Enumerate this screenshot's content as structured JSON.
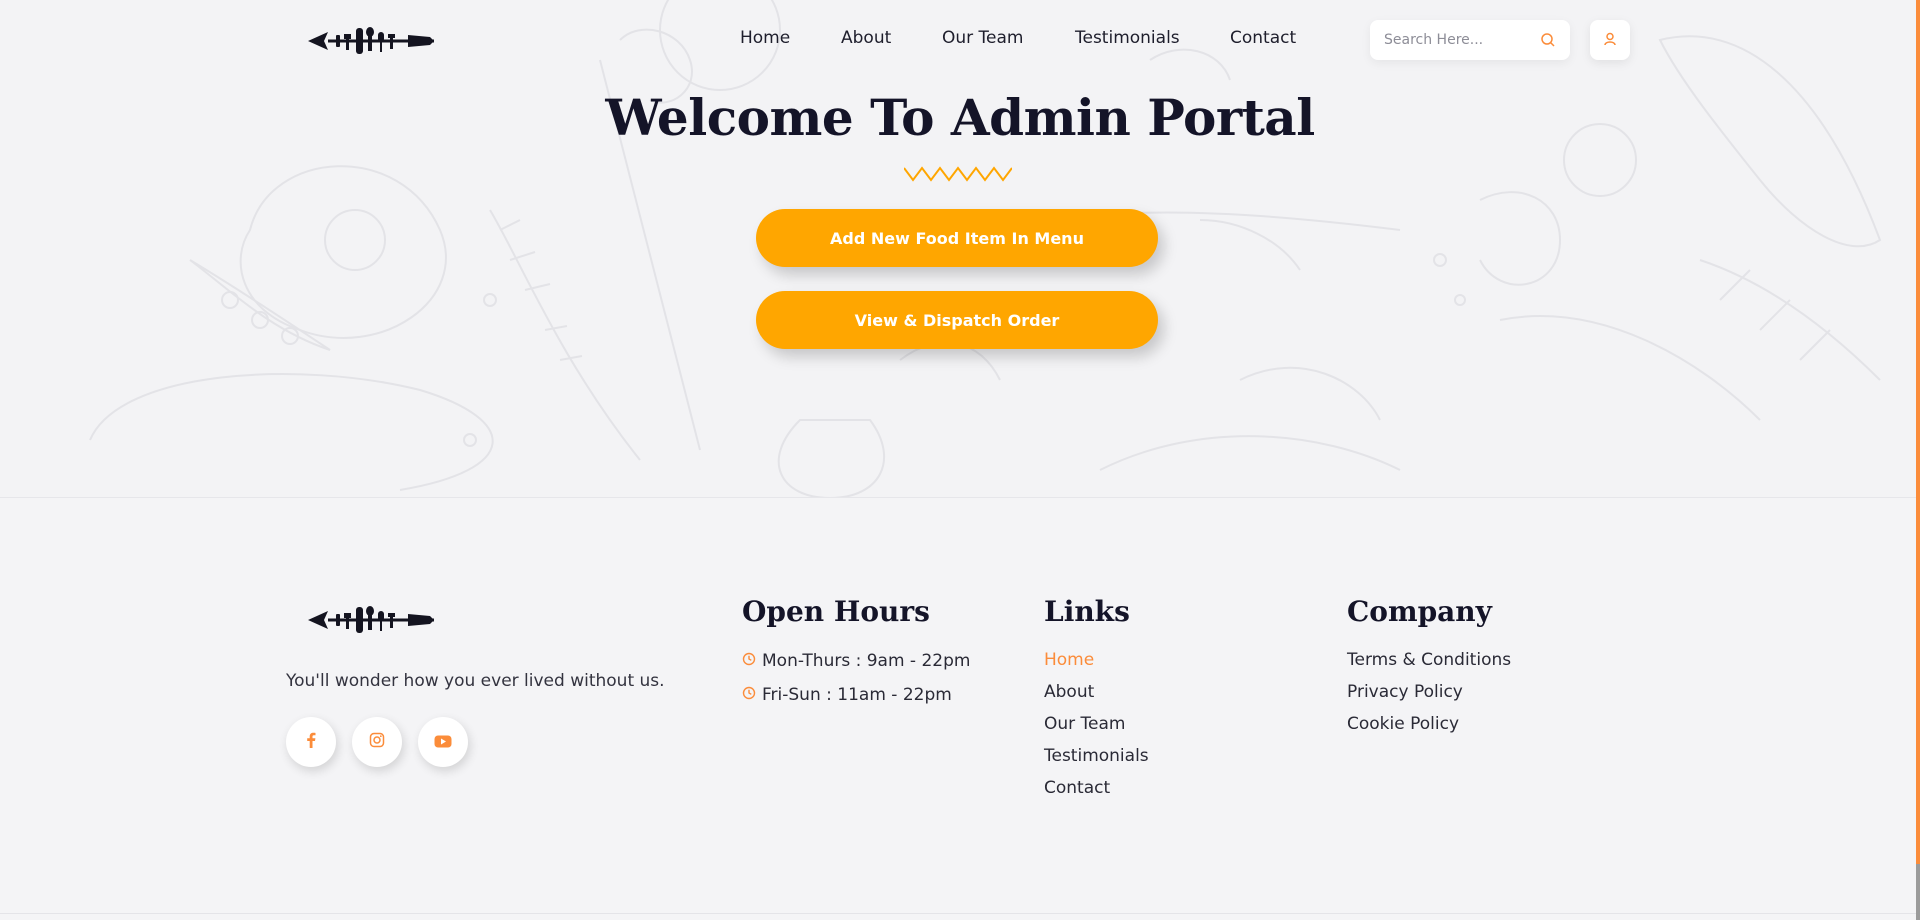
{
  "header": {
    "nav": [
      {
        "label": "Home"
      },
      {
        "label": "About"
      },
      {
        "label": "Our Team"
      },
      {
        "label": "Testimonials"
      },
      {
        "label": "Contact"
      }
    ],
    "search": {
      "placeholder": "Search Here..."
    },
    "icons": {
      "search": "search-icon",
      "user": "user-icon"
    }
  },
  "hero": {
    "title": "Welcome To Admin Portal",
    "buttons": {
      "add_food": "Add New Food Item In Menu",
      "view_orders": "View & Dispatch Order"
    }
  },
  "footer": {
    "tagline": "You'll wonder how you ever lived without us.",
    "socials": [
      "facebook-icon",
      "instagram-icon",
      "youtube-icon"
    ],
    "hours": {
      "title": "Open Hours",
      "items": [
        "Mon-Thurs : 9am - 22pm",
        "Fri-Sun : 11am - 22pm"
      ]
    },
    "links": {
      "title": "Links",
      "items": [
        "Home",
        "About",
        "Our Team",
        "Testimonials",
        "Contact"
      ]
    },
    "company": {
      "title": "Company",
      "items": [
        "Terms & Conditions",
        "Privacy Policy",
        "Cookie Policy"
      ]
    }
  },
  "colors": {
    "accent": "#ffa600",
    "accent_orange": "#fb8c3a",
    "heading": "#141428",
    "background": "#f4f4f6"
  }
}
